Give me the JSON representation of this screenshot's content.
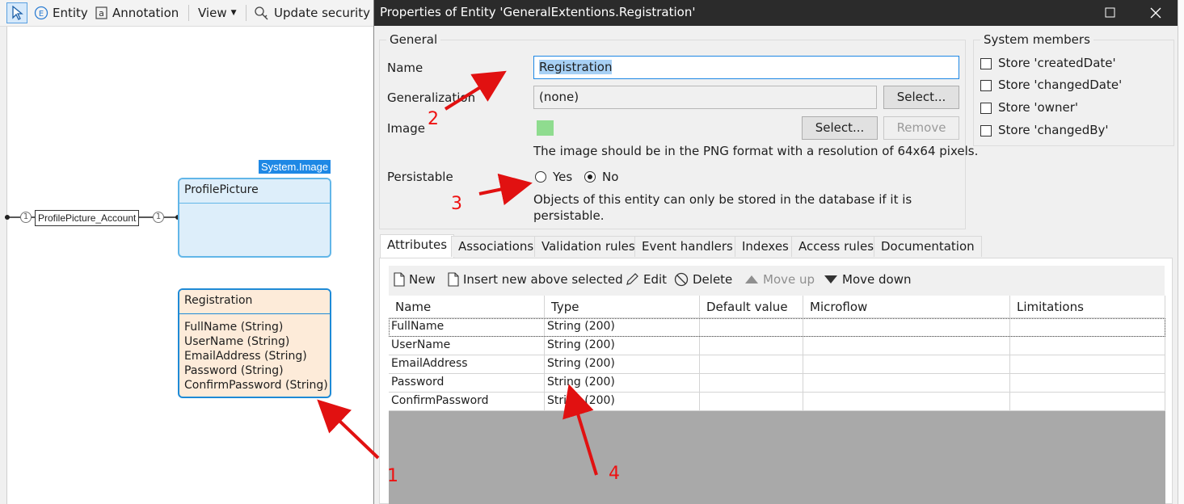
{
  "toolbar": {
    "entity": "Entity",
    "annotation": "Annotation",
    "view": "View",
    "update_security": "Update security"
  },
  "canvas": {
    "system_badge": "System.Image",
    "association_label": "ProfilePicture_Account",
    "multiplicity_left": "1",
    "multiplicity_right": "1",
    "profile_entity": {
      "name": "ProfilePicture"
    },
    "registration_entity": {
      "name": "Registration",
      "attributes": [
        "FullName (String)",
        "UserName (String)",
        "EmailAddress (String)",
        "Password (String)",
        "ConfirmPassword (String)"
      ]
    }
  },
  "dialog": {
    "title": "Properties of Entity 'GeneralExtentions.Registration'",
    "general": {
      "title": "General",
      "name_label": "Name",
      "name_value": "Registration",
      "generalization_label": "Generalization",
      "generalization_value": "(none)",
      "select_label": "Select...",
      "image_label": "Image",
      "image_select_label": "Select...",
      "image_remove_label": "Remove",
      "image_hint": "The image should be in the PNG format with a resolution of 64x64 pixels.",
      "image_color": "#8fdc8f",
      "persistable_label": "Persistable",
      "yes_label": "Yes",
      "no_label": "No",
      "persistable_selected": "No",
      "persistable_hint_1": "Objects of this entity can only be stored in the database if it is",
      "persistable_hint_2": "persistable."
    },
    "system_members": {
      "title": "System members",
      "items": [
        "Store 'createdDate'",
        "Store 'changedDate'",
        "Store 'owner'",
        "Store 'changedBy'"
      ]
    },
    "tabs": [
      "Attributes",
      "Associations",
      "Validation rules",
      "Event handlers",
      "Indexes",
      "Access rules",
      "Documentation"
    ],
    "active_tab": "Attributes",
    "grid_toolbar": {
      "new": "New",
      "insert": "Insert new above selected",
      "edit": "Edit",
      "delete": "Delete",
      "move_up": "Move up",
      "move_down": "Move down"
    },
    "grid": {
      "columns": [
        "Name",
        "Type",
        "Default value",
        "Microflow",
        "Limitations"
      ],
      "rows": [
        [
          "FullName",
          "String (200)",
          "",
          "",
          ""
        ],
        [
          "UserName",
          "String (200)",
          "",
          "",
          ""
        ],
        [
          "EmailAddress",
          "String (200)",
          "",
          "",
          ""
        ],
        [
          "Password",
          "String (200)",
          "",
          "",
          ""
        ],
        [
          "ConfirmPassword",
          "String (200)",
          "",
          "",
          ""
        ]
      ]
    }
  },
  "annotations": {
    "color": "#e11111",
    "labels": [
      "1",
      "2",
      "3",
      "4"
    ]
  }
}
